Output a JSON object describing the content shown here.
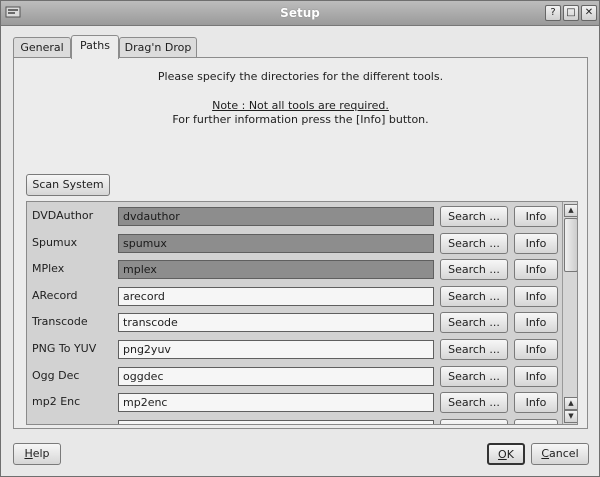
{
  "window": {
    "title": "Setup",
    "buttons": {
      "help": "?",
      "maximize": "□",
      "close": "✕"
    }
  },
  "tabs": [
    "General",
    "Paths",
    "Drag'n Drop"
  ],
  "message": {
    "line1": "Please specify the directories for the different tools.",
    "note": "Note : Not all tools are required.",
    "line3": "For further information press the [Info] button."
  },
  "scan_button": "Scan System",
  "tools": [
    {
      "name": "DVDAuthor",
      "path": "dvdauthor",
      "highlighted": true
    },
    {
      "name": "Spumux",
      "path": "spumux",
      "highlighted": true
    },
    {
      "name": "MPlex",
      "path": "mplex",
      "highlighted": true
    },
    {
      "name": "ARecord",
      "path": "arecord",
      "highlighted": false
    },
    {
      "name": "Transcode",
      "path": "transcode",
      "highlighted": false
    },
    {
      "name": "PNG To YUV",
      "path": "png2yuv",
      "highlighted": false
    },
    {
      "name": "Ogg Dec",
      "path": "oggdec",
      "highlighted": false
    },
    {
      "name": "mp2 Enc",
      "path": "mp2enc",
      "highlighted": false
    },
    {
      "name": "",
      "path": "",
      "highlighted": false
    }
  ],
  "row_buttons": {
    "search": "Search ...",
    "info": "Info"
  },
  "footer": {
    "help": "Help",
    "ok": "OK",
    "cancel": "Cancel"
  },
  "icons": {
    "scroll_up": "scroll-up-icon",
    "scroll_down": "scroll-down-icon"
  },
  "colors": {
    "highlight_field": "#8d8d8d",
    "field": "#f6f6f6"
  }
}
